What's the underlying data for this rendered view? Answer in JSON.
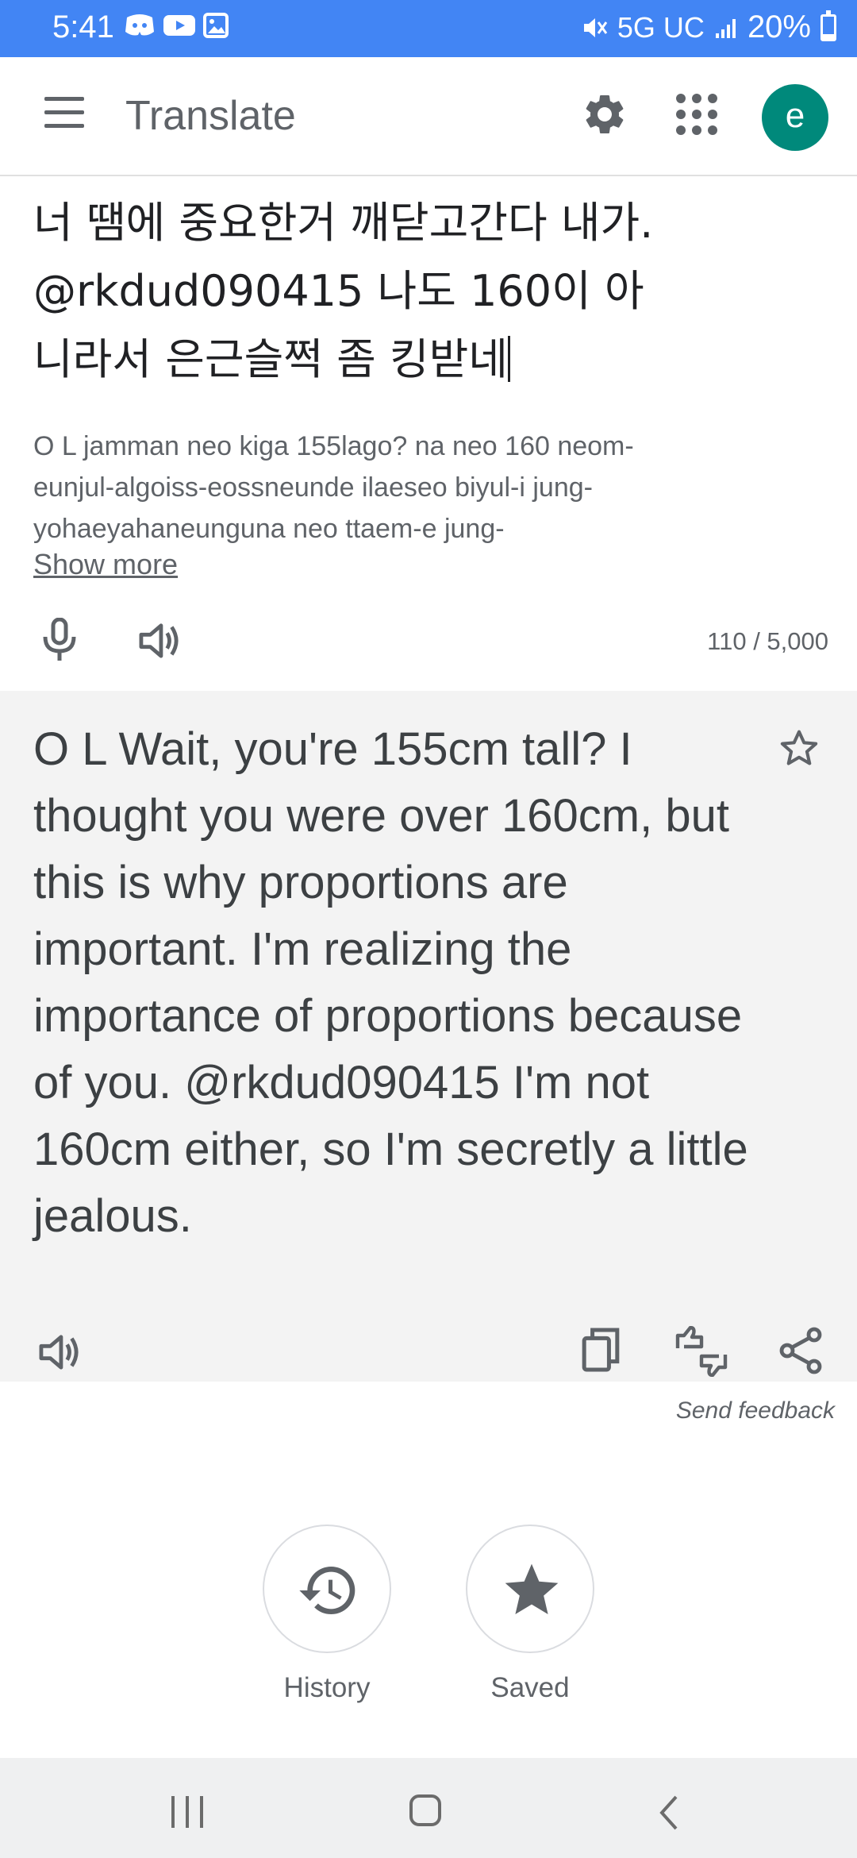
{
  "status_bar": {
    "time": "5:41",
    "network": "5G UC",
    "battery": "20%",
    "battery_level": 0.2,
    "icons_left": [
      "discord-icon",
      "youtube-icon",
      "gallery-icon"
    ],
    "icons_right": [
      "mute-icon",
      "signal-icon",
      "battery-icon"
    ]
  },
  "app_bar": {
    "title": "Translate",
    "avatar_letter": "e"
  },
  "source": {
    "text": "너 땜에 중요한거 깨닫고간다 내가. @rkdud090415 나도 160이 아니라서 은근슬쩍 좀 킹받네",
    "romanization": "O L jamman neo kiga 155lago? na neo 160 neom-eunjul-algoiss-eossneunde ilaeseo biyul-i jung-yohaeyahaneunguna neo ttaem-e jung-",
    "show_more": "Show more",
    "char_count": "110 / 5,000"
  },
  "result": {
    "text": "O L Wait, you're 155cm tall? I thought you were over 160cm, but this is why proportions are important. I'm realizing the importance of proportions because of you. @rkdud090415 I'm not 160cm either, so I'm secretly a little jealous."
  },
  "send_feedback": "Send feedback",
  "bottom": {
    "history_label": "History",
    "saved_label": "Saved"
  },
  "colors": {
    "status_bar": "#4285f4",
    "avatar": "#00897b",
    "result_bg": "#f3f3f3"
  }
}
